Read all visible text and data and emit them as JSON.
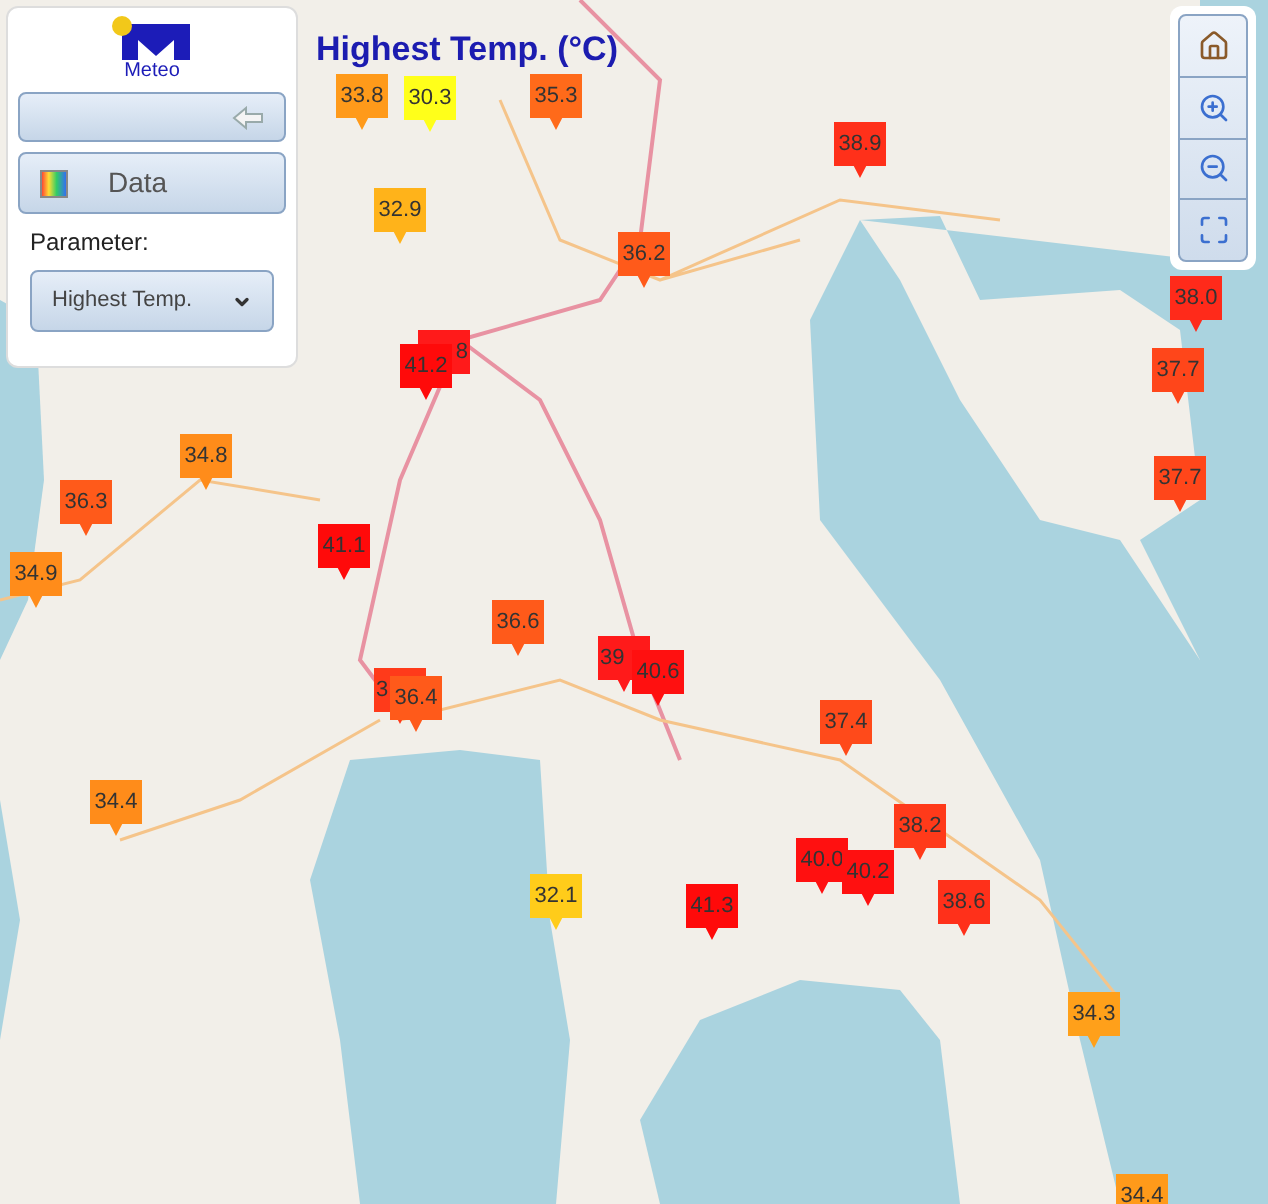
{
  "map_title": "Highest Temp. (°C)",
  "panel": {
    "logo_text": "Meteo",
    "data_button": "Data",
    "parameter_label": "Parameter:",
    "parameter_select": "Highest Temp."
  },
  "markers": [
    {
      "value": "33.8",
      "color": "#ff9a1a"
    },
    {
      "value": "30.3",
      "color": "#ffff1a"
    },
    {
      "value": "35.3",
      "color": "#ff6a1a"
    },
    {
      "value": "32.9",
      "color": "#ffb31a"
    },
    {
      "value": "36.2",
      "color": "#ff5a1a"
    },
    {
      "value": "38.9",
      "color": "#ff301a"
    },
    {
      "value": "38.0",
      "color": "#ff2a1a"
    },
    {
      "value": "37.7",
      "color": "#ff461a"
    },
    {
      "value": "37.7",
      "color": "#ff461a"
    },
    {
      "value": "8",
      "color": "#ff1a1a"
    },
    {
      "value": "41.2",
      "color": "#ff0a0a"
    },
    {
      "value": "34.8",
      "color": "#ff8c1a"
    },
    {
      "value": "36.3",
      "color": "#ff5a1a"
    },
    {
      "value": "34.9",
      "color": "#ff8c1a"
    },
    {
      "value": "41.1",
      "color": "#ff0a0a"
    },
    {
      "value": "36.6",
      "color": "#ff5a1a"
    },
    {
      "value": "39",
      "color": "#ff1a1a"
    },
    {
      "value": "40.6",
      "color": "#ff1010"
    },
    {
      "value": "3",
      "color": "#ff3a1a"
    },
    {
      "value": "36.4",
      "color": "#ff5a1a"
    },
    {
      "value": "34.4",
      "color": "#ff8c1a"
    },
    {
      "value": "37.4",
      "color": "#ff4a1a"
    },
    {
      "value": "38.2",
      "color": "#ff3a1a"
    },
    {
      "value": "40.0",
      "color": "#ff1010"
    },
    {
      "value": "40.2",
      "color": "#ff1010"
    },
    {
      "value": "32.1",
      "color": "#ffcc1a"
    },
    {
      "value": "41.3",
      "color": "#ff0a0a"
    },
    {
      "value": "38.6",
      "color": "#ff301a"
    },
    {
      "value": "34.3",
      "color": "#ffa01a"
    },
    {
      "value": "34.4",
      "color": "#ff9a1a"
    }
  ]
}
